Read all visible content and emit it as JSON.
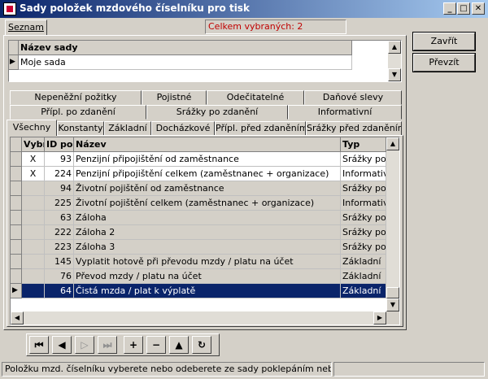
{
  "window": {
    "title": "Sady položek mzdového číselníku pro tisk"
  },
  "tabs_top": {
    "seznam": "Seznam"
  },
  "selected_count": "Celkem vybraných: 2",
  "buttons": {
    "close": "Zavřít",
    "transfer": "Převzít"
  },
  "sets_grid": {
    "header": "Název sady",
    "rows": [
      "Moje sada"
    ]
  },
  "category_tabs": {
    "row1": [
      "Nepeněžní požitky",
      "Pojistné",
      "Odečitatelné",
      "Daňové slevy"
    ],
    "row2": [
      "Přípl. po zdanění",
      "Srážky po zdanění",
      "Informativní"
    ],
    "row3": [
      "Všechny",
      "Konstanty",
      "Základní",
      "Docházkové",
      "Přípl. před zdaněním",
      "Srážky před zdaněním"
    ]
  },
  "items_grid": {
    "headers": {
      "selected": "Vybr",
      "id": "ID po",
      "name": "Název",
      "type": "Typ"
    },
    "rows": [
      {
        "selected": "X",
        "id": "93",
        "name": "Penzijní připojištění od zaměstnance",
        "type": "Srážky po z"
      },
      {
        "selected": "X",
        "id": "224",
        "name": "Penzijní připojištění celkem (zaměstnanec + organizace)",
        "type": "Informativní"
      },
      {
        "selected": "",
        "id": "94",
        "name": "Životní pojištění od zaměstnance",
        "type": "Srážky po z"
      },
      {
        "selected": "",
        "id": "225",
        "name": "Životní pojištění celkem (zaměstnanec + organizace)",
        "type": "Informativní"
      },
      {
        "selected": "",
        "id": "63",
        "name": "Záloha",
        "type": "Srážky po z"
      },
      {
        "selected": "",
        "id": "222",
        "name": "Záloha 2",
        "type": "Srážky po z"
      },
      {
        "selected": "",
        "id": "223",
        "name": "Záloha 3",
        "type": "Srážky po z"
      },
      {
        "selected": "",
        "id": "145",
        "name": "Vyplatit hotově při převodu mzdy / platu na účet",
        "type": "Základní"
      },
      {
        "selected": "",
        "id": "76",
        "name": "Převod mzdy / platu na účet",
        "type": "Základní"
      },
      {
        "selected": "",
        "id": "64",
        "name": "Čistá mzda / plat k výplatě",
        "type": "Základní"
      }
    ]
  },
  "nav_icons": [
    "first-icon",
    "prev-icon",
    "next-icon",
    "last-icon",
    "add-icon",
    "remove-icon",
    "up-icon",
    "refresh-icon"
  ],
  "status": {
    "text": "Položku mzd. číselníku vyberete nebo odeberete ze sady poklepáním nebo mezerou"
  },
  "colors": {
    "titlebar": "#0a246a",
    "selection": "#0a246a",
    "count_text": "#c00000"
  }
}
